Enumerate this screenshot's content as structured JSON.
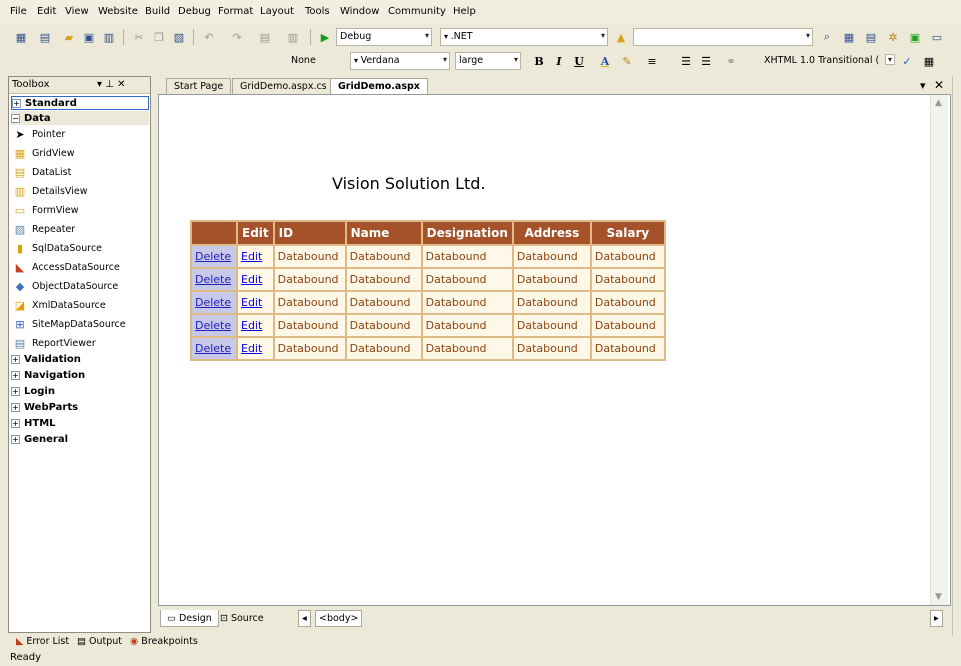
{
  "menu": [
    "File",
    "Edit",
    "View",
    "Website",
    "Build",
    "Debug",
    "Format",
    "Layout",
    "Tools",
    "Window",
    "Community",
    "Help"
  ],
  "toolbar": {
    "config": "Debug",
    "platform": ".NET",
    "block_format": "None",
    "font_name": "Verdana",
    "font_size": "large",
    "bold": "B",
    "italic": "I",
    "underline": "U",
    "doctype": "XHTML 1.0 Transitional ("
  },
  "toolbox": {
    "title": "Toolbox",
    "pin": "▾ ⊥ ✕",
    "categories_top": [
      {
        "label": "Standard",
        "expanded": false
      },
      {
        "label": "Data",
        "expanded": true
      }
    ],
    "items": [
      {
        "label": "Pointer",
        "icon": "pointer-icon"
      },
      {
        "label": "GridView",
        "icon": "gridview-icon"
      },
      {
        "label": "DataList",
        "icon": "datalist-icon"
      },
      {
        "label": "DetailsView",
        "icon": "detailsview-icon"
      },
      {
        "label": "FormView",
        "icon": "formview-icon"
      },
      {
        "label": "Repeater",
        "icon": "repeater-icon"
      },
      {
        "label": "SqlDataSource",
        "icon": "sqldatasource-icon"
      },
      {
        "label": "AccessDataSource",
        "icon": "accessdatasource-icon"
      },
      {
        "label": "ObjectDataSource",
        "icon": "objectdatasource-icon"
      },
      {
        "label": "XmlDataSource",
        "icon": "xmldatasource-icon"
      },
      {
        "label": "SiteMapDataSource",
        "icon": "sitemapdatasource-icon"
      },
      {
        "label": "ReportViewer",
        "icon": "reportviewer-icon"
      }
    ],
    "categories_bottom": [
      "Validation",
      "Navigation",
      "Login",
      "WebParts",
      "HTML",
      "General"
    ]
  },
  "doc_tabs": [
    {
      "label": "Start Page",
      "active": false
    },
    {
      "label": "GridDemo.aspx.cs",
      "active": false
    },
    {
      "label": "GridDemo.aspx",
      "active": true
    }
  ],
  "page": {
    "heading": "Vision Solution Ltd."
  },
  "grid": {
    "headers": [
      "",
      "Edit",
      "ID",
      "Name",
      "Designation",
      "Address",
      "Salary"
    ],
    "delete_label": "Delete",
    "edit_label": "Edit",
    "cell_value": "Databound",
    "row_count": 5,
    "colors": {
      "header_bg": "#a55129",
      "row_bg": "#fff7e7",
      "border": "#deba84",
      "text": "#8c4510"
    }
  },
  "bottom": {
    "design": "Design",
    "source": "Source",
    "tag": "<body>"
  },
  "panels": [
    "Error List",
    "Output",
    "Breakpoints"
  ],
  "status": "Ready"
}
